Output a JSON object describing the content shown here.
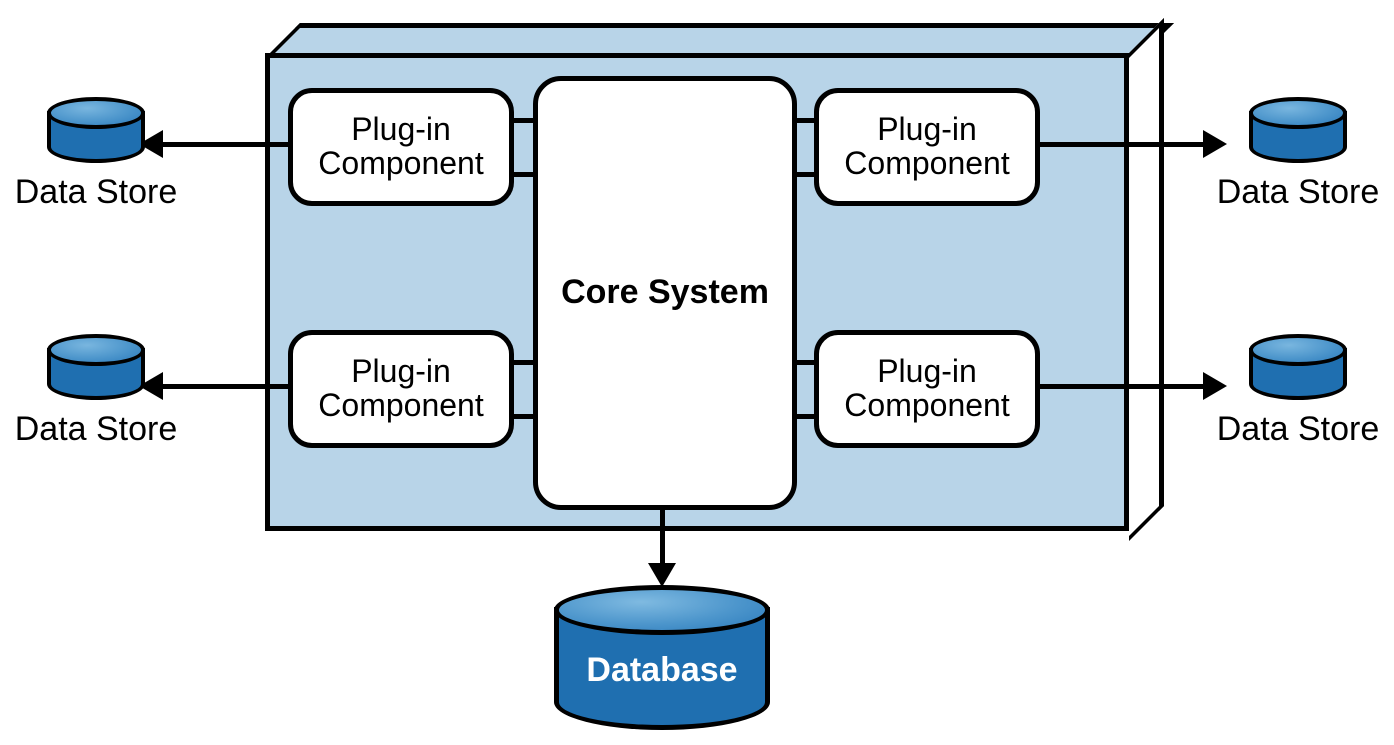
{
  "core": {
    "label": "Core System"
  },
  "plugins": {
    "tl": {
      "label": "Plug-in\nComponent"
    },
    "bl": {
      "label": "Plug-in\nComponent"
    },
    "tr": {
      "label": "Plug-in\nComponent"
    },
    "br": {
      "label": "Plug-in\nComponent"
    }
  },
  "dataStores": {
    "tl": {
      "label": "Data Store"
    },
    "bl": {
      "label": "Data Store"
    },
    "tr": {
      "label": "Data Store"
    },
    "br": {
      "label": "Data Store"
    }
  },
  "database": {
    "label": "Database"
  }
}
